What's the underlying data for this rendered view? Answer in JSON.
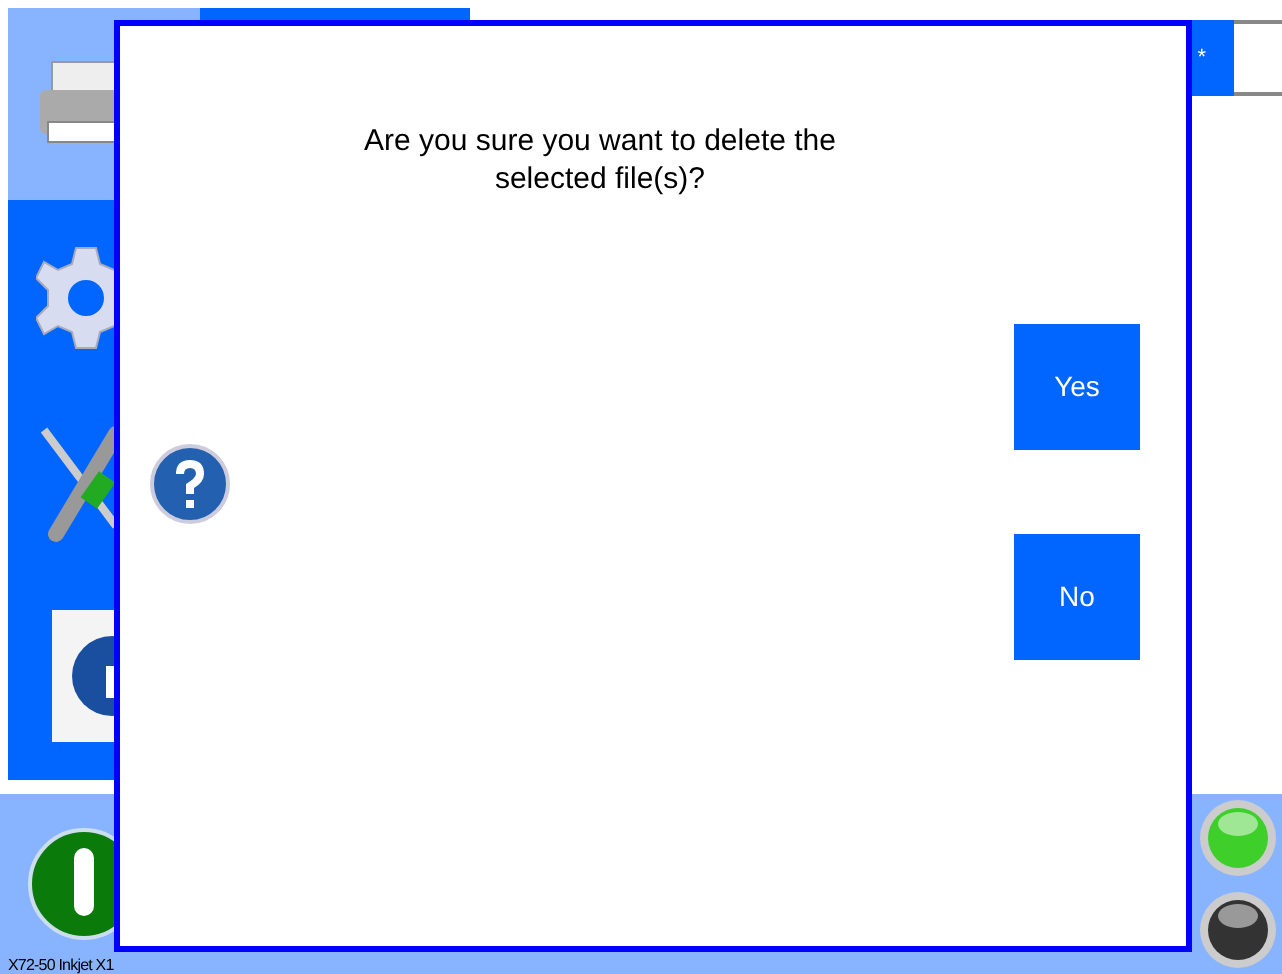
{
  "toolbar": {
    "button_label": "*"
  },
  "indicators": [
    {
      "on": true
    },
    {
      "on": false
    }
  ],
  "status_bar": {
    "text": "X72-50 Inkjet X1"
  },
  "dialog": {
    "message": "Are you sure you want to delete the selected file(s)?",
    "buttons": [
      {
        "label": "Yes"
      },
      {
        "label": "No"
      }
    ]
  }
}
